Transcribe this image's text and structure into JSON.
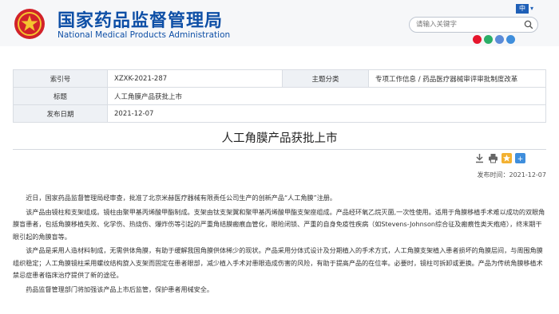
{
  "site": {
    "title_cn": "国家药品监督管理局",
    "title_en": "National Medical Products Administration",
    "lang_label": "中",
    "brand_color": "#0e4fa6"
  },
  "search": {
    "placeholder": "请输入关键字",
    "icon": "search-icon"
  },
  "socials": [
    {
      "icon": "weibo-icon",
      "color": "#e6162d"
    },
    {
      "icon": "wechat-icon",
      "color": "#2aae67"
    },
    {
      "icon": "miniprogram-icon",
      "color": "#5b8bd8"
    },
    {
      "icon": "app-icon",
      "color": "#3f8edc"
    }
  ],
  "meta": {
    "index_label": "索引号",
    "index_value": "XZXK-2021-287",
    "category_label": "主题分类",
    "category_value": "专项工作信息 / 药品医疗器械审评审批制度改革",
    "title_label": "标题",
    "title_value": "人工角膜产品获批上市",
    "date_label": "发布日期",
    "date_value": "2021-12-07"
  },
  "article": {
    "title": "人工角膜产品获批上市",
    "date_line": "发布时间：2021-12-07",
    "paragraphs": [
      "近日，国家药品监督管理局经审查，批准了北京米赫医疗器械有限责任公司生产的创新产品“人工角膜”注册。",
      "该产品由镜柱和支架组成。镜柱由聚甲基丙烯酸甲酯制成。支架由钛支架翼和聚甲基丙烯酸甲酯支架座组成。产品经环氧乙烷灭菌,一次性使用。适用于角膜移植手术难以成功的双眼角膜盲患者，包括角膜移植失败、化学伤、热烧伤、爆炸伤等引起的严重角结膜瘢痕血管化，眼睑闭锁、严重的自身免疫性疾病（如Stevens-Johnson综合征及瘢痕性类天疱疮），终末期干眼引起的角膜盲等。",
      "该产品是采用人造材料制成，无需供体角膜，有助于缓解我国角膜供体稀少的现状。产品采用分体式设计及分期植入的手术方式，人工角膜支架植入患者损坏的角膜层间，与周围角膜组织稳定；人工角膜镜柱采用螺纹结构旋入支架而固定在患者眼部，减少植入手术对患眼造成伤害的风险，有助于提高产品的在位率。必要时，镜柱可拆卸或更换。产品为传统角膜移植术禁忌症患者临床治疗提供了新的途径。",
      "药品监督管理部门将加强该产品上市后监管，保护患者用械安全。"
    ]
  },
  "tools": [
    {
      "icon": "download-icon",
      "color": "#666666"
    },
    {
      "icon": "print-icon",
      "color": "#666666"
    },
    {
      "icon": "star-icon",
      "color": "#e4a12b"
    },
    {
      "icon": "share-icon",
      "color": "#3f8edc"
    }
  ]
}
